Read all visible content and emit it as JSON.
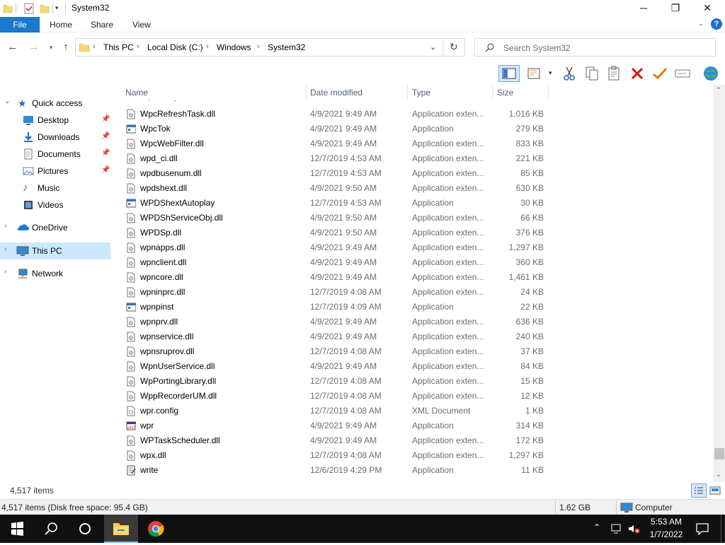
{
  "window": {
    "title": "System32",
    "minimize": "─",
    "maximize": "❐",
    "close": "✕"
  },
  "ribbon": {
    "tabs": [
      {
        "label": "File"
      },
      {
        "label": "Home"
      },
      {
        "label": "Share"
      },
      {
        "label": "View"
      }
    ],
    "help": "?"
  },
  "address": {
    "crumbs": [
      "This PC",
      "Local Disk (C:)",
      "Windows",
      "System32"
    ],
    "search_placeholder": "Search System32"
  },
  "nav": {
    "quick_access": "Quick access",
    "items": [
      {
        "label": "Desktop",
        "pinned": true
      },
      {
        "label": "Downloads",
        "pinned": true
      },
      {
        "label": "Documents",
        "pinned": true
      },
      {
        "label": "Pictures",
        "pinned": true
      },
      {
        "label": "Music",
        "pinned": false
      },
      {
        "label": "Videos",
        "pinned": false
      }
    ],
    "onedrive": "OneDrive",
    "thispc": "This PC",
    "network": "Network"
  },
  "columns": {
    "name": "Name",
    "date": "Date modified",
    "type": "Type",
    "size": "Size"
  },
  "files": [
    {
      "name": "WpcRefreshTask.dll",
      "date": "4/9/2021 9:49 AM",
      "type": "Application exten...",
      "size": "1,016 KB",
      "icon": "dll-icon"
    },
    {
      "name": "WpcTok",
      "date": "4/9/2021 9:49 AM",
      "type": "Application",
      "size": "279 KB",
      "icon": "exe-icon"
    },
    {
      "name": "WpcWebFilter.dll",
      "date": "4/9/2021 9:49 AM",
      "type": "Application exten...",
      "size": "833 KB",
      "icon": "dll-icon"
    },
    {
      "name": "wpd_ci.dll",
      "date": "12/7/2019 4:53 AM",
      "type": "Application exten...",
      "size": "221 KB",
      "icon": "dll-icon"
    },
    {
      "name": "wpdbusenum.dll",
      "date": "12/7/2019 4:53 AM",
      "type": "Application exten...",
      "size": "85 KB",
      "icon": "dll-icon"
    },
    {
      "name": "wpdshext.dll",
      "date": "4/9/2021 9:50 AM",
      "type": "Application exten...",
      "size": "630 KB",
      "icon": "dll-icon"
    },
    {
      "name": "WPDShextAutoplay",
      "date": "12/7/2019 4:53 AM",
      "type": "Application",
      "size": "30 KB",
      "icon": "exe-icon"
    },
    {
      "name": "WPDShServiceObj.dll",
      "date": "4/9/2021 9:50 AM",
      "type": "Application exten...",
      "size": "66 KB",
      "icon": "dll-icon"
    },
    {
      "name": "WPDSp.dll",
      "date": "4/9/2021 9:50 AM",
      "type": "Application exten...",
      "size": "376 KB",
      "icon": "dll-icon"
    },
    {
      "name": "wpnapps.dll",
      "date": "4/9/2021 9:49 AM",
      "type": "Application exten...",
      "size": "1,297 KB",
      "icon": "dll-icon"
    },
    {
      "name": "wpnclient.dll",
      "date": "4/9/2021 9:49 AM",
      "type": "Application exten...",
      "size": "360 KB",
      "icon": "dll-icon"
    },
    {
      "name": "wpncore.dll",
      "date": "4/9/2021 9:49 AM",
      "type": "Application exten...",
      "size": "1,461 KB",
      "icon": "dll-icon"
    },
    {
      "name": "wpninprc.dll",
      "date": "12/7/2019 4:08 AM",
      "type": "Application exten...",
      "size": "24 KB",
      "icon": "dll-icon"
    },
    {
      "name": "wpnpinst",
      "date": "12/7/2019 4:09 AM",
      "type": "Application",
      "size": "22 KB",
      "icon": "exe-icon"
    },
    {
      "name": "wpnprv.dll",
      "date": "4/9/2021 9:49 AM",
      "type": "Application exten...",
      "size": "636 KB",
      "icon": "dll-icon"
    },
    {
      "name": "wpnservice.dll",
      "date": "4/9/2021 9:49 AM",
      "type": "Application exten...",
      "size": "240 KB",
      "icon": "dll-icon"
    },
    {
      "name": "wpnsruprov.dll",
      "date": "12/7/2019 4:08 AM",
      "type": "Application exten...",
      "size": "37 KB",
      "icon": "dll-icon"
    },
    {
      "name": "WpnUserService.dll",
      "date": "4/9/2021 9:49 AM",
      "type": "Application exten...",
      "size": "84 KB",
      "icon": "dll-icon"
    },
    {
      "name": "WpPortingLibrary.dll",
      "date": "12/7/2019 4:08 AM",
      "type": "Application exten...",
      "size": "15 KB",
      "icon": "dll-icon"
    },
    {
      "name": "WppRecorderUM.dll",
      "date": "12/7/2019 4:08 AM",
      "type": "Application exten...",
      "size": "12 KB",
      "icon": "dll-icon"
    },
    {
      "name": "wpr.config",
      "date": "12/7/2019 4:08 AM",
      "type": "XML Document",
      "size": "1 KB",
      "icon": "config-icon"
    },
    {
      "name": "wpr",
      "date": "4/9/2021 9:49 AM",
      "type": "Application",
      "size": "314 KB",
      "icon": "wpr-icon"
    },
    {
      "name": "WPTaskScheduler.dll",
      "date": "4/9/2021 9:49 AM",
      "type": "Application exten...",
      "size": "172 KB",
      "icon": "dll-icon"
    },
    {
      "name": "wpx.dll",
      "date": "12/7/2019 4:08 AM",
      "type": "Application exten...",
      "size": "1,297 KB",
      "icon": "dll-icon"
    },
    {
      "name": "write",
      "date": "12/6/2019 4:29 PM",
      "type": "Application",
      "size": "11 KB",
      "icon": "write-icon"
    }
  ],
  "status": {
    "item_count": "4,517 items",
    "disk_info": "4,517 items (Disk free space: 95.4 GB)",
    "size": "1.62 GB",
    "location": "Computer"
  },
  "taskbar": {
    "time": "5:53 AM",
    "date": "1/7/2022"
  }
}
